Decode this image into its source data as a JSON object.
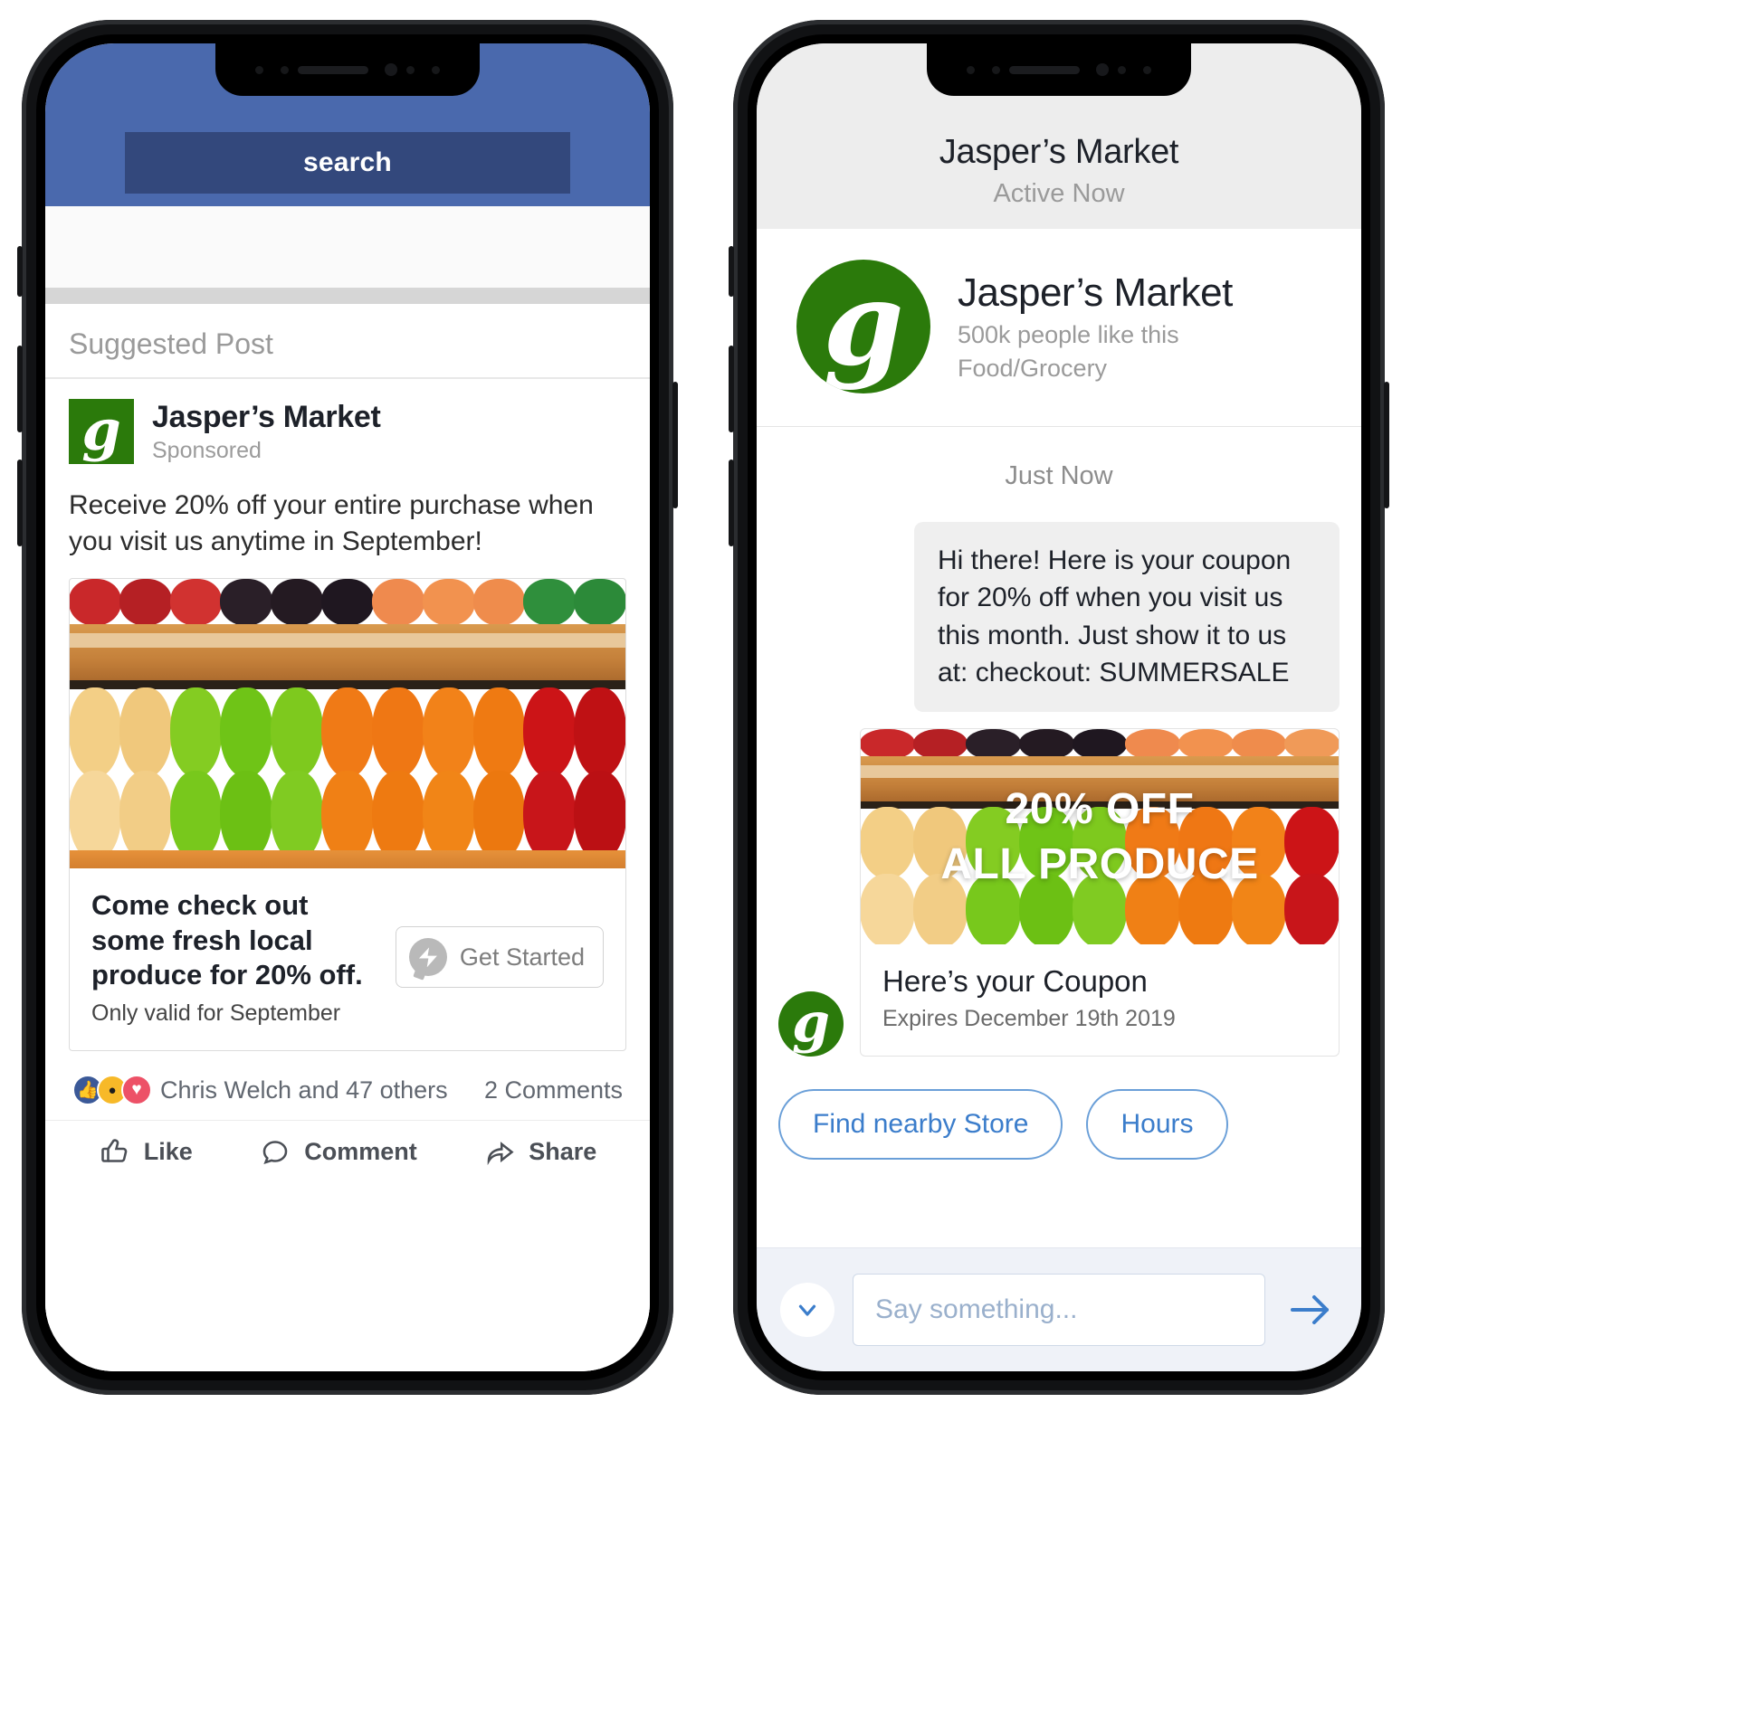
{
  "left_phone": {
    "app": "Facebook",
    "search": {
      "label": "search"
    },
    "feed": {
      "suggested_label": "Suggested Post",
      "post": {
        "page_name": "Jasper’s Market",
        "sponsored_label": "Sponsored",
        "body": "Receive 20% off your entire purchase when you visit us anytime in September!",
        "card": {
          "headline": "Come check out some fresh local produce for 20% off.",
          "subline": "Only valid for September",
          "cta_label": "Get Started",
          "cta_icon": "messenger-icon"
        },
        "engagement": {
          "reactions": [
            "like-reaction-icon",
            "wow-reaction-icon",
            "love-reaction-icon"
          ],
          "reactors_text": "Chris Welch and 47 others",
          "comments_text": "2 Comments"
        },
        "actions": [
          {
            "label": "Like",
            "icon": "thumbs-up-icon"
          },
          {
            "label": "Comment",
            "icon": "comment-bubble-icon"
          },
          {
            "label": "Share",
            "icon": "share-arrow-icon"
          }
        ]
      }
    }
  },
  "right_phone": {
    "app": "Messenger",
    "header": {
      "title": "Jasper’s Market",
      "status": "Active Now"
    },
    "profile": {
      "name": "Jasper’s Market",
      "likes": "500k people like this",
      "category": "Food/Grocery",
      "avatar_icon": "jaspers-market-logo"
    },
    "timestamp": "Just Now",
    "message": {
      "text": "Hi there! Here is your coupon for 20% off when you visit us this month. Just show it to us at: checkout: SUMMERSALE"
    },
    "coupon": {
      "overlay_line1": "20% OFF",
      "overlay_line2": "ALL PRODUCE",
      "title": "Here’s your Coupon",
      "expiry": "Expires December 19th 2019"
    },
    "quick_replies": [
      {
        "label": "Find nearby Store"
      },
      {
        "label": "Hours"
      }
    ],
    "composer": {
      "placeholder": "Say something...",
      "value": "",
      "expand_icon": "chevron-down-icon",
      "send_icon": "send-arrow-icon"
    }
  },
  "colors": {
    "facebook_blue": "#4a69ad",
    "facebook_search": "#33487c",
    "brand_green": "#2b7a0b",
    "messenger_link": "#3b7dcb",
    "bubble_grey": "#efefef"
  }
}
